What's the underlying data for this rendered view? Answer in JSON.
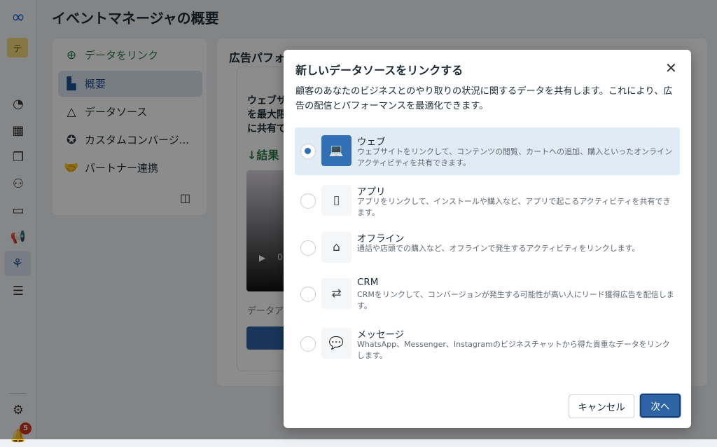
{
  "header": {
    "title": "イベントマネージャの概要"
  },
  "sidebar": {
    "avatar": "テ",
    "notification_count": "5"
  },
  "left_nav": {
    "items": [
      {
        "label": "データをリンク",
        "icon": "plus-circle-icon"
      },
      {
        "label": "概要",
        "icon": "dashboard-icon"
      },
      {
        "label": "データソース",
        "icon": "nodes-icon"
      },
      {
        "label": "カスタムコンバージ...",
        "icon": "star-badge-icon"
      },
      {
        "label": "パートナー連携",
        "icon": "handshake-icon"
      }
    ]
  },
  "background": {
    "panel_title": "広告パフォ",
    "line1": "ウェブサ",
    "line2": "を最大限",
    "line3": "に共有で",
    "results": "↓結果",
    "video_time": "0",
    "footer_text": "データア"
  },
  "modal": {
    "title": "新しいデータソースをリンクする",
    "description": "顧客のあなたのビジネスとのやり取りの状況に関するデータを共有します。これにより、広告の配信とパフォーマンスを最適化できます。",
    "options": [
      {
        "label": "ウェブ",
        "desc": "ウェブサイトをリンクして、コンテンツの閲覧、カートへの追加、購入といったオンラインアクティビティを共有できます。",
        "icon": "laptop-icon",
        "selected": true
      },
      {
        "label": "アプリ",
        "desc": "アプリをリンクして、インストールや購入など、アプリで起こるアクティビティを共有できます。",
        "icon": "phone-icon",
        "selected": false
      },
      {
        "label": "オフライン",
        "desc": "通話や店頭での購入など、オフラインで発生するアクティビティをリンクします。",
        "icon": "store-icon",
        "selected": false
      },
      {
        "label": "CRM",
        "desc": "CRMをリンクして、コンバージョンが発生する可能性が高い人にリード獲得広告を配信します。",
        "icon": "crm-icon",
        "selected": false
      },
      {
        "label": "メッセージ",
        "desc": "WhatsApp、Messenger、Instagramのビジネスチャットから得た貴重なデータをリンクします。",
        "icon": "chat-icon",
        "selected": false
      }
    ],
    "cancel": "キャンセル",
    "next": "次へ"
  },
  "colors": {
    "accent": "#2e63a5",
    "selected_bg": "#e1ebf5"
  }
}
